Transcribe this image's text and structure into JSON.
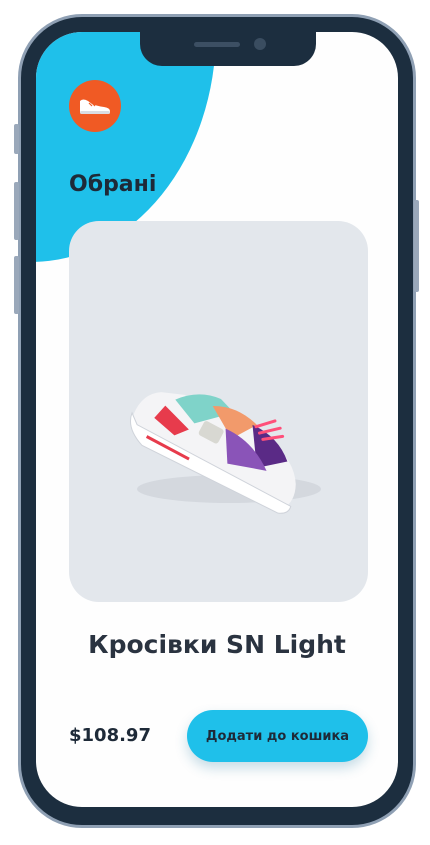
{
  "header": {
    "logo_icon": "sneaker-icon",
    "title": "Обрані"
  },
  "product": {
    "image_icon": "sneaker-image",
    "name": "Кросівки SN Light",
    "price": "$108.97"
  },
  "actions": {
    "add_to_cart_label": "Додати до кошика"
  },
  "colors": {
    "accent": "#1fc0ea",
    "logo": "#f05a24",
    "frame": "#1c2e3f",
    "text": "#1e2a38",
    "card": "#e3e7ec"
  }
}
